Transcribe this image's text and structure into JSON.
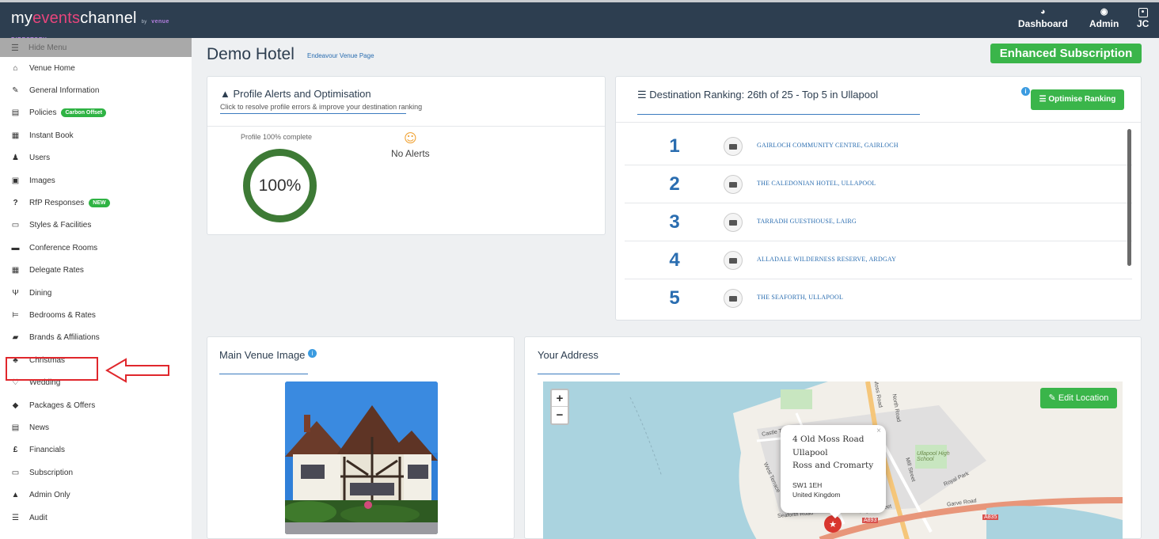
{
  "header": {
    "brand_prefix": "my",
    "brand_events": "events",
    "brand_suffix": "channel",
    "brand_by": "by",
    "brand_venue_directory": "venue DIRECTORY.com",
    "nav": [
      {
        "label": "Dashboard",
        "icon": "dashboard-icon"
      },
      {
        "label": "Admin",
        "icon": "admin-icon"
      },
      {
        "label": "JC",
        "icon": "user-badge-icon"
      }
    ]
  },
  "sidebar": {
    "hide_menu": "Hide Menu",
    "items": [
      {
        "label": "Venue Home",
        "icon": "home-icon",
        "glyph": "⌂"
      },
      {
        "label": "General Information",
        "icon": "edit-icon",
        "glyph": "✎"
      },
      {
        "label": "Policies",
        "icon": "document-icon",
        "glyph": "▤",
        "badge": "Carbon Offset"
      },
      {
        "label": "Instant Book",
        "icon": "calendar-icon",
        "glyph": "▦"
      },
      {
        "label": "Users",
        "icon": "user-icon",
        "glyph": "♟"
      },
      {
        "label": "Images",
        "icon": "image-icon",
        "glyph": "▣"
      },
      {
        "label": "RfP Responses",
        "icon": "question-icon",
        "glyph": "?",
        "badge": "NEW"
      },
      {
        "label": "Styles & Facilities",
        "icon": "monitor-icon",
        "glyph": "▭"
      },
      {
        "label": "Conference Rooms",
        "icon": "briefcase-icon",
        "glyph": "▬"
      },
      {
        "label": "Delegate Rates",
        "icon": "calculator-icon",
        "glyph": "▦"
      },
      {
        "label": "Dining",
        "icon": "cutlery-icon",
        "glyph": "Ψ"
      },
      {
        "label": "Bedrooms & Rates",
        "icon": "bed-icon",
        "glyph": "⊨"
      },
      {
        "label": "Brands & Affiliations",
        "icon": "book-icon",
        "glyph": "▰"
      },
      {
        "label": "Christmas",
        "icon": "tree-icon",
        "glyph": "♣"
      },
      {
        "label": "Wedding",
        "icon": "heart-icon",
        "glyph": "♡"
      },
      {
        "label": "Packages & Offers",
        "icon": "tag-icon",
        "glyph": "◆"
      },
      {
        "label": "News",
        "icon": "newspaper-icon",
        "glyph": "▤"
      },
      {
        "label": "Financials",
        "icon": "pound-icon",
        "glyph": "£"
      },
      {
        "label": "Subscription",
        "icon": "credit-card-icon",
        "glyph": "▭"
      },
      {
        "label": "Admin Only",
        "icon": "warning-icon",
        "glyph": "▲"
      },
      {
        "label": "Audit",
        "icon": "list-icon",
        "glyph": "☰"
      }
    ]
  },
  "main": {
    "title": "Demo Hotel",
    "page_link": "Endeavour Venue Page",
    "subscription_button": "Enhanced Subscription",
    "profile": {
      "title": "Profile Alerts and Optimisation",
      "subtitle": "Click to resolve profile errors & improve your destination ranking",
      "complete_label": "Profile 100% complete",
      "percent": "100%",
      "progress": 1.0,
      "alerts": "No Alerts"
    },
    "ranking": {
      "title": "Destination Ranking: 26th of 25 - Top 5 in Ullapool",
      "button": "Optimise Ranking",
      "rows": [
        {
          "rank": "1",
          "name": "GAIRLOCH COMMUNITY CENTRE, GAIRLOCH"
        },
        {
          "rank": "2",
          "name": "THE CALEDONIAN HOTEL, ULLAPOOL"
        },
        {
          "rank": "3",
          "name": "TARRADH GUESTHOUSE, LAIRG"
        },
        {
          "rank": "4",
          "name": "ALLADALE WILDERNESS RESERVE, ARDGAY"
        },
        {
          "rank": "5",
          "name": "THE SEAFORTH, ULLAPOOL"
        }
      ]
    },
    "venue_image": {
      "title": "Main Venue Image"
    },
    "address": {
      "title": "Your Address",
      "edit_button": "Edit Location",
      "zoom_in": "+",
      "zoom_out": "−",
      "popup": {
        "line1": "4 Old Moss Road",
        "line2": "Ullapool",
        "line3": "Ross and Cromarty",
        "postcode": "SW1 1EH",
        "country": "United Kingdom"
      },
      "map_labels": [
        "North Road",
        "Mill Street",
        "Ullapool High School",
        "Royal Park",
        "Garve Road",
        "A835",
        "A893",
        "Argyle Street",
        "West Terrace",
        "Castle Terrace",
        "Moss Road",
        "Seaforth Road"
      ]
    }
  },
  "colors": {
    "topbar": "#2d3e50",
    "accent_green": "#3ab54a",
    "link_blue": "#2a6db0",
    "highlight_red": "#e0272c"
  }
}
